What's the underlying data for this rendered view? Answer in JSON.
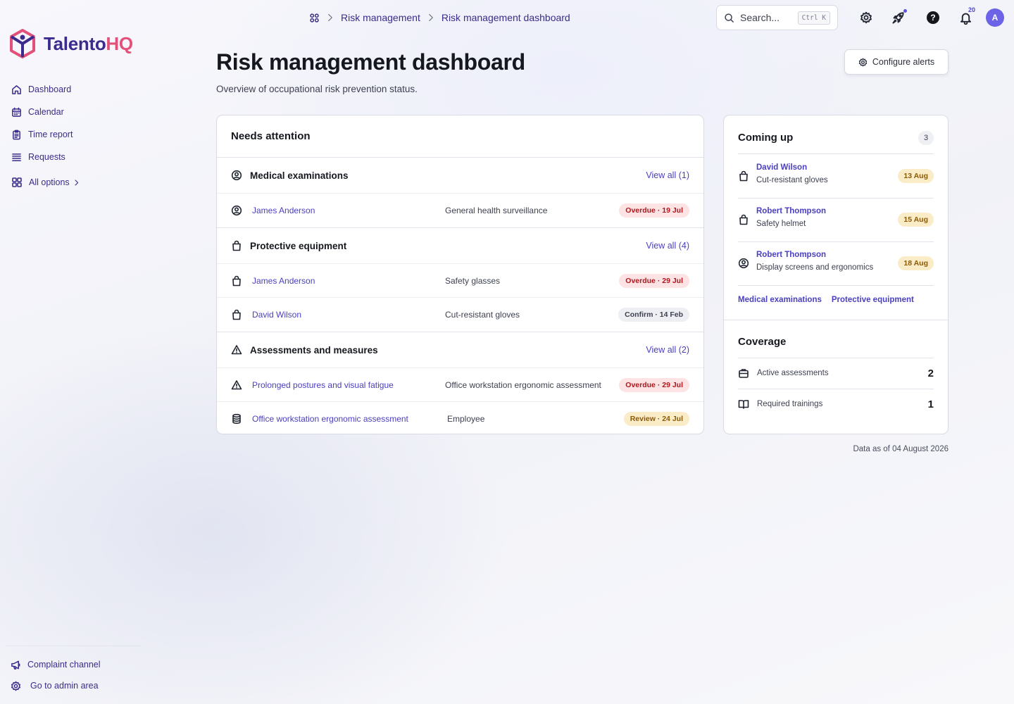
{
  "brand": {
    "name_part1": "Talento",
    "name_part2": "HQ",
    "color_primary": "#3b2b8f",
    "color_accent": "#e2517a"
  },
  "sidebar": {
    "items": [
      {
        "label": "Dashboard",
        "icon": "home-icon"
      },
      {
        "label": "Calendar",
        "icon": "calendar-icon"
      },
      {
        "label": "Time report",
        "icon": "clipboard-icon"
      },
      {
        "label": "Requests",
        "icon": "list-icon"
      }
    ],
    "all_options": "All options",
    "bottom": [
      {
        "label": "Complaint channel",
        "icon": "megaphone-icon"
      },
      {
        "label": "Go to admin area",
        "icon": "gear-icon"
      }
    ]
  },
  "header": {
    "breadcrumb": [
      "Risk management",
      "Risk management dashboard"
    ],
    "search_placeholder": "Search...",
    "search_shortcut": "Ctrl K",
    "notifications_count": "20",
    "avatar_initial": "A"
  },
  "page": {
    "title": "Risk management dashboard",
    "subtitle": "Overview of occupational risk prevention status.",
    "configure_button": "Configure alerts"
  },
  "needs_attention": {
    "title": "Needs attention",
    "sections": [
      {
        "title": "Medical examinations",
        "view_all": "View all (1)",
        "rows": [
          {
            "name": "James Anderson",
            "desc": "General health surveillance",
            "status": "Overdue · 19 Jul",
            "tone": "red"
          }
        ]
      },
      {
        "title": "Protective equipment",
        "view_all": "View all (4)",
        "rows": [
          {
            "name": "James Anderson",
            "desc": "Safety glasses",
            "status": "Overdue · 29 Jul",
            "tone": "red"
          },
          {
            "name": "David Wilson",
            "desc": "Cut-resistant gloves",
            "status": "Confirm · 14 Feb",
            "tone": "grey"
          }
        ]
      },
      {
        "title": "Assessments and measures",
        "view_all": "View all (2)",
        "rows": [
          {
            "name": "Prolonged postures and visual fatigue",
            "desc": "Office workstation ergonomic assessment",
            "status": "Overdue · 29 Jul",
            "tone": "red"
          },
          {
            "name": "Office workstation ergonomic assessment",
            "desc": "Employee",
            "status": "Review · 24 Jul",
            "tone": "amber"
          }
        ]
      }
    ]
  },
  "coming_up": {
    "title": "Coming up",
    "count": "3",
    "items": [
      {
        "name": "David Wilson",
        "desc": "Cut-resistant gloves",
        "date": "13 Aug",
        "icon": "bag-icon"
      },
      {
        "name": "Robert Thompson",
        "desc": "Safety helmet",
        "date": "15 Aug",
        "icon": "bag-icon"
      },
      {
        "name": "Robert Thompson",
        "desc": "Display screens and ergonomics",
        "date": "18 Aug",
        "icon": "user-circle-icon"
      }
    ],
    "links": [
      "Medical examinations",
      "Protective equipment"
    ]
  },
  "coverage": {
    "title": "Coverage",
    "rows": [
      {
        "label": "Active assessments",
        "value": "2",
        "icon": "briefcase-icon"
      },
      {
        "label": "Required trainings",
        "value": "1",
        "icon": "book-icon"
      }
    ]
  },
  "footer": {
    "data_as_of": "Data as of 04 August 2026"
  }
}
